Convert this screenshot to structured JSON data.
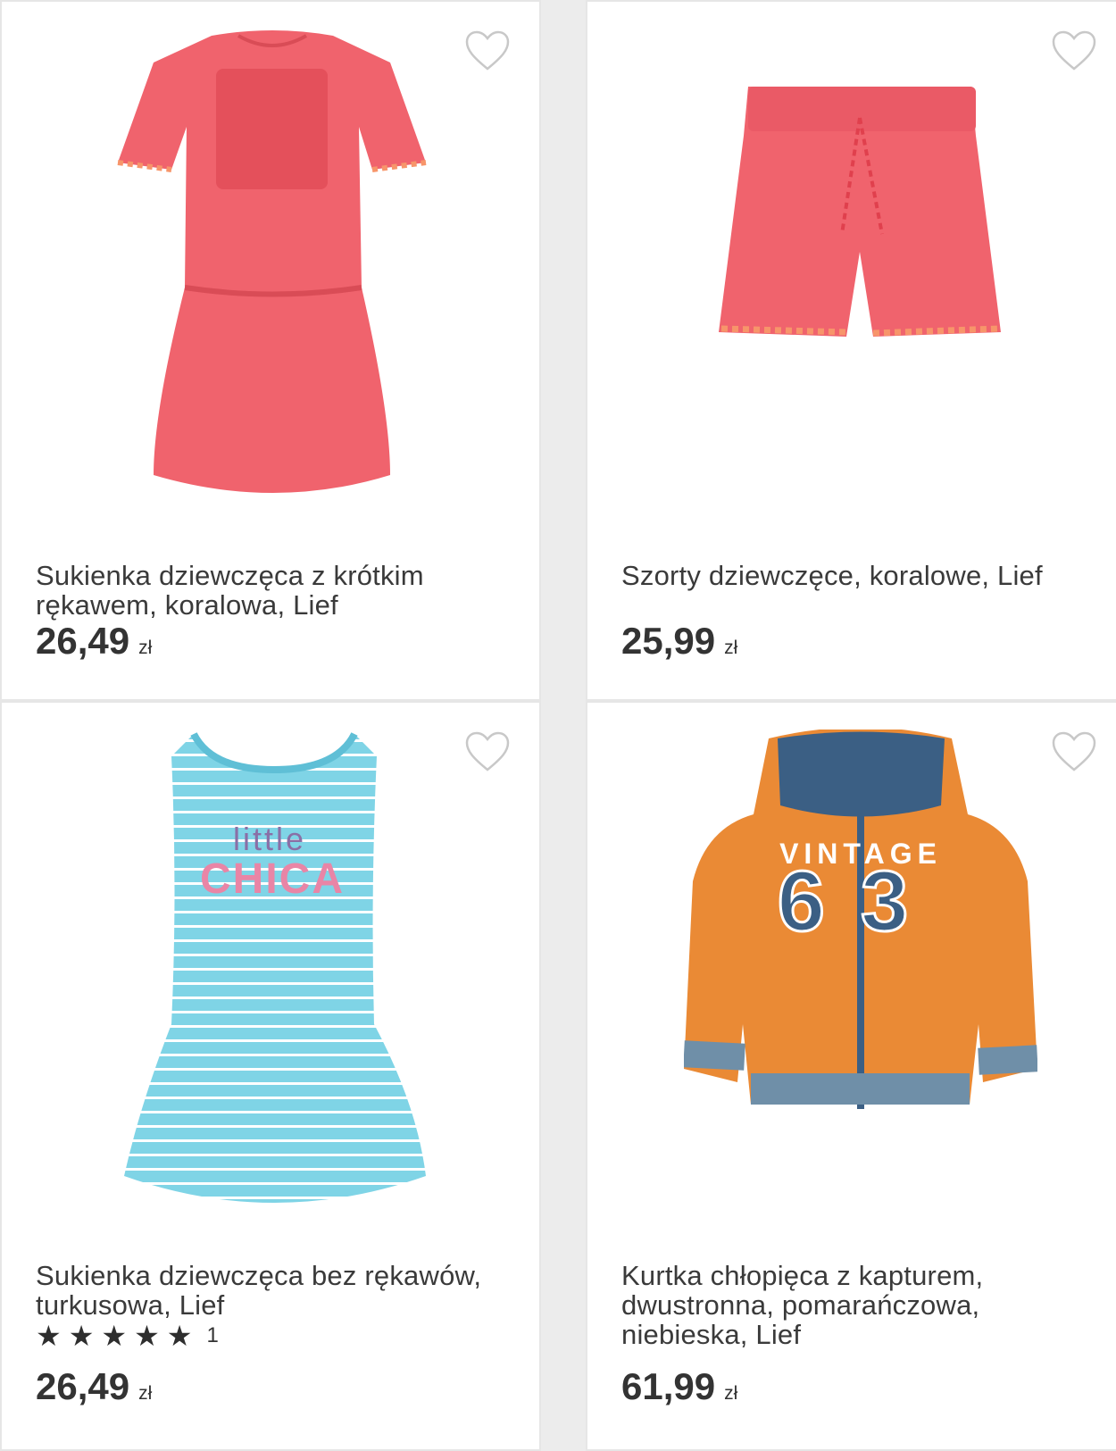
{
  "products": [
    {
      "title": "Sukienka dziewczęca z krótkim rękawem, koralowa, Lief",
      "price": "26,49",
      "currency": "zł",
      "image_icon": "coral-dress-image"
    },
    {
      "title": "Szorty dziewczęce, koralowe, Lief",
      "price": "25,99",
      "currency": "zł",
      "image_icon": "coral-shorts-image"
    },
    {
      "title": "Sukienka dziewczęca bez rękawów, turkusowa, Lief",
      "price": "26,49",
      "currency": "zł",
      "rating": {
        "stars": 5,
        "max": 5,
        "count": "1"
      },
      "image_icon": "turquoise-dress-image",
      "print_top": "little",
      "print_bottom": "CHICA"
    },
    {
      "title": "Kurtka chłopięca z kapturem, dwustronna, pomarańczowa, niebieska, Lief",
      "price": "61,99",
      "currency": "zł",
      "image_icon": "orange-jacket-image",
      "print_top": "VINTAGE",
      "print_number": "63"
    }
  ],
  "colors": {
    "coral": "#f0636d",
    "turquoise": "#7fd4e6",
    "orange": "#ea8a35",
    "navy": "#3b5f84"
  }
}
